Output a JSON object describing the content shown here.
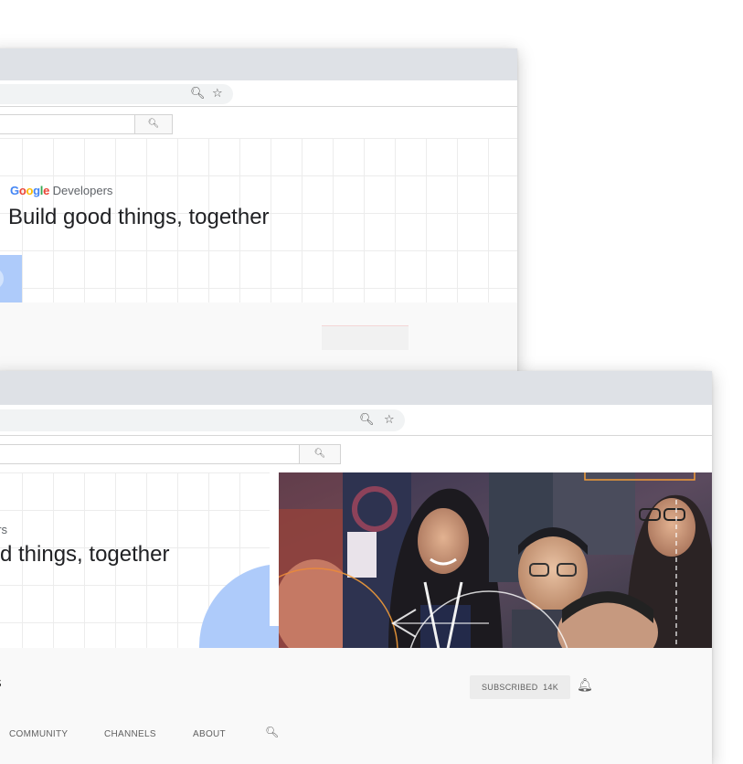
{
  "back_window": {
    "browser": {
      "zoom_icon": "zoom-icon",
      "star_icon": "bookmark-star-icon"
    },
    "search_icon": "search-icon",
    "banner": {
      "brand_prefix": "Google",
      "brand_suffix": " Developers",
      "headline": "Build good things, together"
    }
  },
  "front_window": {
    "browser": {
      "zoom_icon": "zoom-icon",
      "star_icon": "bookmark-star-icon"
    },
    "search_icon": "search-icon",
    "banner": {
      "brand_fragment": "ers",
      "headline_fragment": "d things, together"
    },
    "channel": {
      "name_fragment": "s",
      "subscribe_label": "SUBSCRIBED",
      "subscriber_count": "14K"
    },
    "tabs": [
      {
        "label": "COMMUNITY"
      },
      {
        "label": "CHANNELS"
      },
      {
        "label": "ABOUT"
      }
    ]
  },
  "colors": {
    "accent_blue": "#aecbfa",
    "chrome_titlebar": "#dee1e6",
    "google_blue": "#4285f4",
    "google_red": "#ea4335",
    "google_yellow": "#fbbc05",
    "google_green": "#34a853"
  }
}
